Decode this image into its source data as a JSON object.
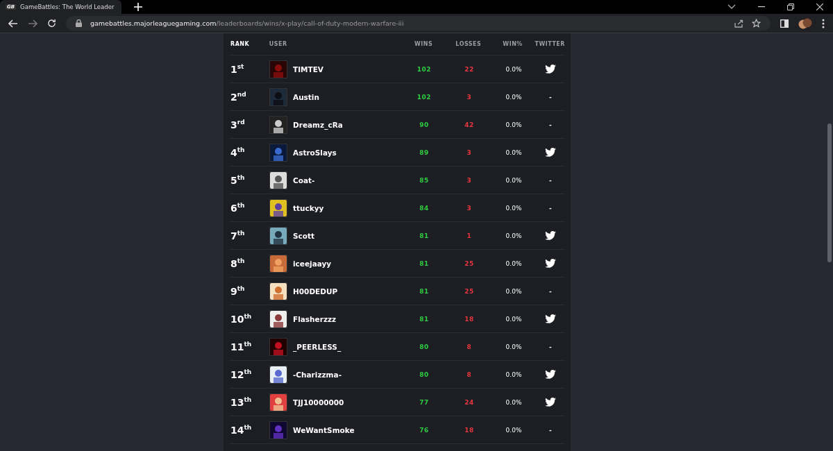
{
  "browser": {
    "tab": {
      "title": "GameBattles: The World Leader",
      "favicon": "GB",
      "selected": true
    },
    "url": {
      "host": "gamebattles.majorleaguegaming.com",
      "path": "/leaderboards/wins/x-play/call-of-duty-modern-warfare-iii"
    }
  },
  "table": {
    "columns": [
      "RANK",
      "USER",
      "WINS",
      "LOSSES",
      "WIN%",
      "TWITTER"
    ],
    "rows": [
      {
        "rank": "1$^{st}$",
        "user": "TIMTEV",
        "wins": "102",
        "losses": "22",
        "win_pct": "0.0%",
        "twitter": {
          "kind": "icon"
        }
      },
      {
        "rank": "2$^{nd}$",
        "user": "Austin",
        "wins": "102",
        "losses": "3",
        "win_pct": "0.0%",
        "twitter": {
          "kind": "text",
          "text": "-"
        }
      },
      {
        "rank": "3$^{rd}$",
        "user": "Dreamz_cRa",
        "wins": "90",
        "losses": "42",
        "win_pct": "0.0%",
        "twitter": {
          "kind": "text",
          "text": "-"
        }
      },
      {
        "rank": "4$^{th}$",
        "user": "AstroSlays",
        "wins": "89",
        "losses": "3",
        "win_pct": "0.0%",
        "twitter": {
          "kind": "icon"
        }
      },
      {
        "rank": "5$^{th}$",
        "user": "Coat-",
        "wins": "85",
        "losses": "3",
        "win_pct": "0.0%",
        "twitter": {
          "kind": "text",
          "text": "-"
        }
      },
      {
        "rank": "6$^{th}$",
        "user": "ttuckyy",
        "wins": "84",
        "losses": "3",
        "win_pct": "0.0%",
        "twitter": {
          "kind": "text",
          "text": "-"
        }
      },
      {
        "rank": "7$^{th}$",
        "user": "Scott",
        "wins": "81",
        "losses": "1",
        "win_pct": "0.0%",
        "twitter": {
          "kind": "icon"
        }
      },
      {
        "rank": "8$^{th}$",
        "user": "iceejaayy",
        "wins": "81",
        "losses": "25",
        "win_pct": "0.0%",
        "twitter": {
          "kind": "icon"
        }
      },
      {
        "rank": "9$^{th}$",
        "user": "H00DEDUP",
        "wins": "81",
        "losses": "25",
        "win_pct": "0.0%",
        "twitter": {
          "kind": "text",
          "text": "-"
        }
      },
      {
        "rank": "10$^{th}$",
        "user": "Flasherzzz",
        "wins": "81",
        "losses": "18",
        "win_pct": "0.0%",
        "twitter": {
          "kind": "icon"
        }
      },
      {
        "rank": "11$^{th}$",
        "user": "_PEERLESS_",
        "wins": "80",
        "losses": "8",
        "win_pct": "0.0%",
        "twitter": {
          "kind": "text",
          "text": "-"
        }
      },
      {
        "rank": "12$^{th}$",
        "user": "-Charizzma-",
        "wins": "80",
        "losses": "8",
        "win_pct": "0.0%",
        "twitter": {
          "kind": "icon"
        }
      },
      {
        "rank": "13$^{th}$",
        "user": "TJJ10000000",
        "wins": "77",
        "losses": "24",
        "win_pct": "0.0%",
        "twitter": {
          "kind": "icon"
        }
      },
      {
        "rank": "14$^{th}$",
        "user": "WeWantSmoke",
        "wins": "76",
        "losses": "18",
        "win_pct": "0.0%",
        "twitter": {
          "kind": "text",
          "text": "-"
        }
      }
    ]
  }
}
